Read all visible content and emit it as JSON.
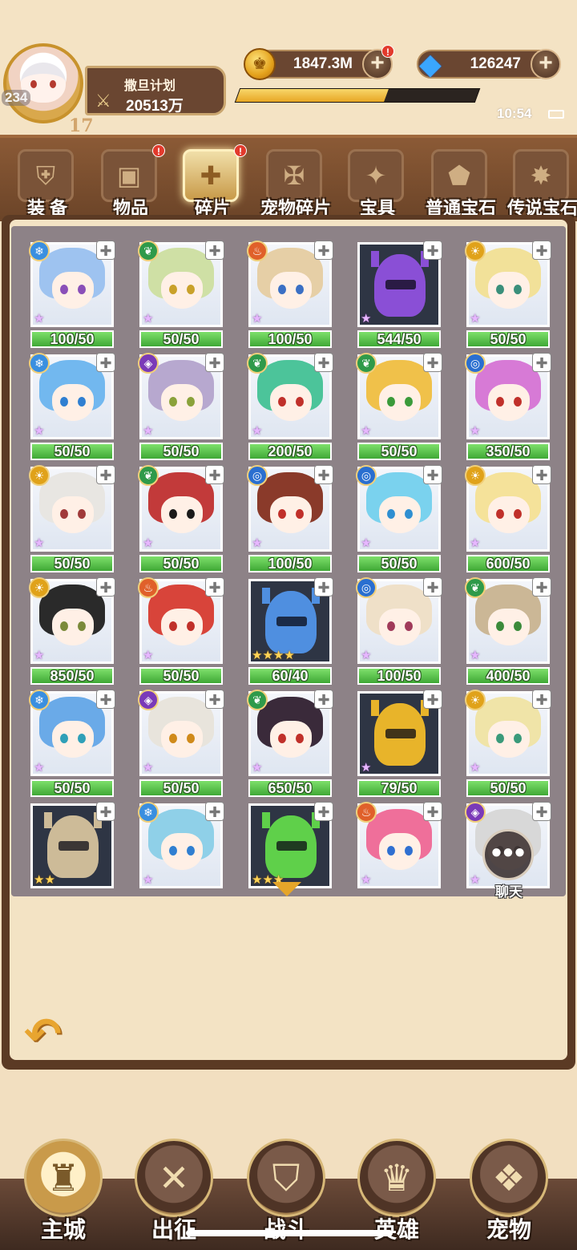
{
  "player": {
    "level": "234",
    "sub_level": "17",
    "name": "撒旦计划",
    "power": "20513万",
    "xp_fraction": 0.62
  },
  "resources": {
    "gold": "1847.3M",
    "gems": "126247"
  },
  "status": {
    "time": "10:54"
  },
  "tabs": [
    {
      "label": "装 备",
      "icon": "shield-sword-icon",
      "alert": false,
      "active": false
    },
    {
      "label": "物品",
      "icon": "chest-icon",
      "alert": true,
      "active": false
    },
    {
      "label": "碎片",
      "icon": "puzzle-icon",
      "alert": true,
      "active": true
    },
    {
      "label": "宠物碎片",
      "icon": "pet-puzzle-icon",
      "alert": false,
      "active": false
    },
    {
      "label": "宝具",
      "icon": "treasure-icon",
      "alert": false,
      "active": false
    },
    {
      "label": "普通宝石",
      "icon": "gem-icon",
      "alert": false,
      "active": false
    },
    {
      "label": "传说宝石",
      "icon": "legend-gem-icon",
      "alert": false,
      "active": false
    }
  ],
  "fragments": [
    {
      "count": "100/50",
      "element": "ice",
      "stars": 1,
      "kind": "hero",
      "hair": "#9ec3f0",
      "eye": "#8a4fb8"
    },
    {
      "count": "50/50",
      "element": "nature",
      "stars": 1,
      "kind": "hero",
      "hair": "#cfe0a5",
      "eye": "#c9a12a"
    },
    {
      "count": "100/50",
      "element": "fire",
      "stars": 1,
      "kind": "hero",
      "hair": "#e6cfa6",
      "eye": "#3a6fc4"
    },
    {
      "count": "544/50",
      "element": "",
      "stars": 1,
      "kind": "helm",
      "hair": "#8a4fd6",
      "eye": ""
    },
    {
      "count": "50/50",
      "element": "light",
      "stars": 1,
      "kind": "hero",
      "hair": "#f2e199",
      "eye": "#3a8f7a"
    },
    {
      "count": "50/50",
      "element": "ice",
      "stars": 1,
      "kind": "hero",
      "hair": "#72b8ef",
      "eye": "#2f7fd1"
    },
    {
      "count": "50/50",
      "element": "dark",
      "stars": 1,
      "kind": "hero",
      "hair": "#b7a8cf",
      "eye": "#8aa23a"
    },
    {
      "count": "200/50",
      "element": "nature",
      "stars": 1,
      "kind": "hero",
      "hair": "#4cc49a",
      "eye": "#c0302a"
    },
    {
      "count": "50/50",
      "element": "nature",
      "stars": 1,
      "kind": "hero",
      "hair": "#f0c14a",
      "eye": "#3a9a3a"
    },
    {
      "count": "350/50",
      "element": "water",
      "stars": 1,
      "kind": "hero",
      "hair": "#d77ad6",
      "eye": "#c0302a"
    },
    {
      "count": "50/50",
      "element": "light",
      "stars": 1,
      "kind": "hero",
      "hair": "#e8e6e2",
      "eye": "#a03a3a"
    },
    {
      "count": "50/50",
      "element": "nature",
      "stars": 1,
      "kind": "hero",
      "hair": "#c23a3a",
      "eye": "#1a1a1a"
    },
    {
      "count": "100/50",
      "element": "water",
      "stars": 1,
      "kind": "hero",
      "hair": "#8a3a2a",
      "eye": "#c0302a"
    },
    {
      "count": "50/50",
      "element": "water",
      "stars": 1,
      "kind": "hero",
      "hair": "#7ad2ee",
      "eye": "#2f8fd1"
    },
    {
      "count": "600/50",
      "element": "light",
      "stars": 1,
      "kind": "hero",
      "hair": "#f5e29a",
      "eye": "#c0302a"
    },
    {
      "count": "850/50",
      "element": "light",
      "stars": 1,
      "kind": "hero",
      "hair": "#2a2a2a",
      "eye": "#7a8a3a"
    },
    {
      "count": "50/50",
      "element": "fire",
      "stars": 1,
      "kind": "hero",
      "hair": "#d8443a",
      "eye": "#c0302a"
    },
    {
      "count": "60/40",
      "element": "",
      "stars": 4,
      "kind": "helm",
      "hair": "#4f8fe0",
      "eye": ""
    },
    {
      "count": "100/50",
      "element": "water",
      "stars": 1,
      "kind": "hero",
      "hair": "#efe0c8",
      "eye": "#a03a5a"
    },
    {
      "count": "400/50",
      "element": "nature",
      "stars": 1,
      "kind": "hero",
      "hair": "#cbb796",
      "eye": "#3a8a3a"
    },
    {
      "count": "50/50",
      "element": "ice",
      "stars": 1,
      "kind": "hero",
      "hair": "#6aaae8",
      "eye": "#2fa0b8"
    },
    {
      "count": "50/50",
      "element": "dark",
      "stars": 1,
      "kind": "hero",
      "hair": "#e8e4dc",
      "eye": "#d08a1a"
    },
    {
      "count": "650/50",
      "element": "nature",
      "stars": 1,
      "kind": "hero",
      "hair": "#3a2a3a",
      "eye": "#c0302a"
    },
    {
      "count": "79/50",
      "element": "",
      "stars": 1,
      "kind": "helm",
      "hair": "#e8b42a",
      "eye": ""
    },
    {
      "count": "50/50",
      "element": "light",
      "stars": 1,
      "kind": "hero",
      "hair": "#f0e4a8",
      "eye": "#3a9a7a"
    },
    {
      "count": "",
      "element": "",
      "stars": 2,
      "kind": "helm",
      "hair": "#cdbb98",
      "eye": ""
    },
    {
      "count": "",
      "element": "ice",
      "stars": 1,
      "kind": "hero",
      "hair": "#8fd0e8",
      "eye": "#2f7fd1"
    },
    {
      "count": "",
      "element": "",
      "stars": 3,
      "kind": "helm",
      "hair": "#5fd04a",
      "eye": ""
    },
    {
      "count": "",
      "element": "fire",
      "stars": 1,
      "kind": "hero",
      "hair": "#ef6f9a",
      "eye": "#2f6fd1"
    },
    {
      "count": "",
      "element": "dark",
      "stars": 1,
      "kind": "hero",
      "hair": "#d8d8d8",
      "eye": "#7a7a7a"
    }
  ],
  "element_colors": {
    "ice": "#3a8fe0",
    "nature": "#2f9a4a",
    "fire": "#e0602a",
    "light": "#e0a21a",
    "dark": "#7a3ab8",
    "water": "#2a6fd0"
  },
  "chat": {
    "label": "聊天"
  },
  "nav": [
    {
      "label": "主城",
      "icon": "castle-icon",
      "active": true
    },
    {
      "label": "出征",
      "icon": "crossed-axes-icon",
      "active": false
    },
    {
      "label": "战斗",
      "icon": "battle-shield-icon",
      "active": false
    },
    {
      "label": "英雄",
      "icon": "hero-hood-icon",
      "active": false
    },
    {
      "label": "宠物",
      "icon": "pet-dragon-icon",
      "active": false
    }
  ]
}
